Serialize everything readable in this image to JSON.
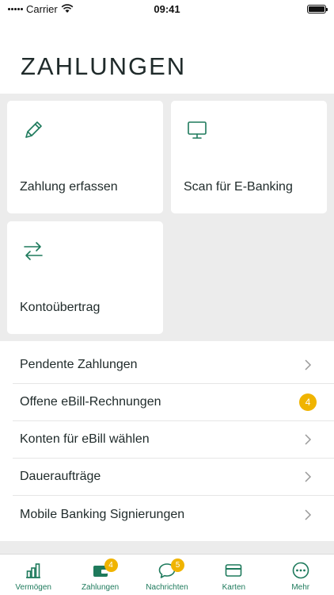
{
  "status_bar": {
    "carrier": "Carrier",
    "time": "09:41"
  },
  "page": {
    "title": "ZAHLUNGEN"
  },
  "tiles": [
    {
      "label": "Zahlung erfassen",
      "icon": "pencil-icon"
    },
    {
      "label": "Scan für E-Banking",
      "icon": "monitor-icon"
    },
    {
      "label": "Kontoübertrag",
      "icon": "transfer-arrows-icon"
    }
  ],
  "list": [
    {
      "label": "Pendente Zahlungen"
    },
    {
      "label": "Offene eBill-Rechnungen",
      "badge": "4"
    },
    {
      "label": "Konten für eBill wählen"
    },
    {
      "label": "Daueraufträge"
    },
    {
      "label": "Mobile Banking Signierungen"
    }
  ],
  "tabbar": {
    "items": [
      {
        "label": "Vermögen",
        "icon": "bar-chart-icon"
      },
      {
        "label": "Zahlungen",
        "icon": "wallet-icon",
        "badge": "4",
        "active": true
      },
      {
        "label": "Nachrichten",
        "icon": "chat-bubble-icon",
        "badge": "5"
      },
      {
        "label": "Karten",
        "icon": "credit-card-icon"
      },
      {
        "label": "Mehr",
        "icon": "more-dots-icon"
      }
    ]
  },
  "colors": {
    "accent": "#1e7a5c",
    "badge": "#f0b400",
    "background": "#ececec"
  }
}
